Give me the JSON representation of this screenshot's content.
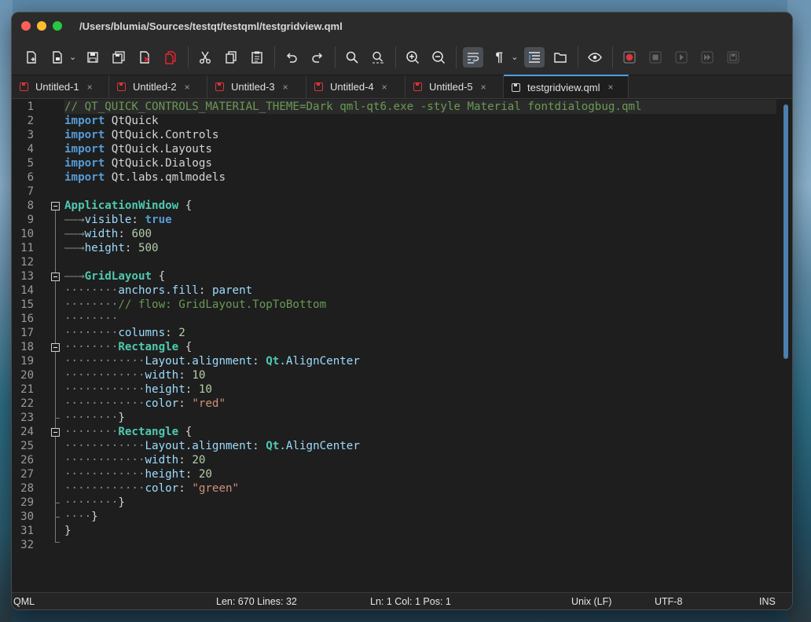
{
  "window": {
    "title": "/Users/blumia/Sources/testqt/testqml/testgridview.qml"
  },
  "toolbar": {
    "buttons": [
      {
        "icon": "new-document-icon"
      },
      {
        "icon": "open-file-icon"
      },
      {
        "icon": "save-icon"
      },
      {
        "icon": "save-all-icon"
      },
      {
        "icon": "close-file-icon"
      },
      {
        "icon": "close-all-icon"
      },
      {
        "icon": "cut-icon"
      },
      {
        "icon": "copy-icon"
      },
      {
        "icon": "paste-icon"
      },
      {
        "icon": "undo-icon"
      },
      {
        "icon": "redo-icon"
      },
      {
        "icon": "find-icon"
      },
      {
        "icon": "find-replace-icon"
      },
      {
        "icon": "zoom-in-icon"
      },
      {
        "icon": "zoom-out-icon"
      },
      {
        "icon": "word-wrap-icon"
      },
      {
        "icon": "show-whitespace-icon"
      },
      {
        "icon": "indent-guide-icon"
      },
      {
        "icon": "folder-icon"
      },
      {
        "icon": "preview-eye-icon"
      },
      {
        "icon": "record-macro-icon"
      },
      {
        "icon": "stop-macro-icon"
      },
      {
        "icon": "play-macro-icon"
      },
      {
        "icon": "run-macro-multiple-icon"
      },
      {
        "icon": "save-macro-icon"
      }
    ]
  },
  "tabs": [
    {
      "label": "Untitled-1",
      "close": "×",
      "active": false
    },
    {
      "label": "Untitled-2",
      "close": "×",
      "active": false
    },
    {
      "label": "Untitled-3",
      "close": "×",
      "active": false
    },
    {
      "label": "Untitled-4",
      "close": "×",
      "active": false
    },
    {
      "label": "Untitled-5",
      "close": "×",
      "active": false
    },
    {
      "label": "testgridview.qml",
      "close": "×",
      "active": true
    }
  ],
  "editor": {
    "line_numbers": [
      "1",
      "2",
      "3",
      "4",
      "5",
      "6",
      "7",
      "8",
      "9",
      "10",
      "11",
      "12",
      "13",
      "14",
      "15",
      "16",
      "17",
      "18",
      "19",
      "20",
      "21",
      "22",
      "23",
      "24",
      "25",
      "26",
      "27",
      "28",
      "29",
      "30",
      "31",
      "32"
    ],
    "lines": [
      [
        {
          "cls": "c",
          "text": "// QT_QUICK_CONTROLS_MATERIAL_THEME=Dark qml-qt6.exe -style Material fontdialogbug.qml"
        }
      ],
      [
        {
          "cls": "k",
          "text": "import"
        },
        {
          "cls": "",
          "text": " QtQuick"
        }
      ],
      [
        {
          "cls": "k",
          "text": "import"
        },
        {
          "cls": "",
          "text": " QtQuick.Controls"
        }
      ],
      [
        {
          "cls": "k",
          "text": "import"
        },
        {
          "cls": "",
          "text": " QtQuick.Layouts"
        }
      ],
      [
        {
          "cls": "k",
          "text": "import"
        },
        {
          "cls": "",
          "text": " QtQuick.Dialogs"
        }
      ],
      [
        {
          "cls": "k",
          "text": "import"
        },
        {
          "cls": "",
          "text": " Qt.labs.qmlmodels"
        }
      ],
      [
        {
          "cls": "",
          "text": ""
        }
      ],
      [
        {
          "cls": "t",
          "text": "ApplicationWindow"
        },
        {
          "cls": "",
          "text": " {"
        }
      ],
      [
        {
          "cls": "a",
          "text": "——→"
        },
        {
          "cls": "p",
          "text": "visible"
        },
        {
          "cls": "",
          "text": ": "
        },
        {
          "cls": "k",
          "text": "true"
        }
      ],
      [
        {
          "cls": "a",
          "text": "——→"
        },
        {
          "cls": "p",
          "text": "width"
        },
        {
          "cls": "",
          "text": ": "
        },
        {
          "cls": "n",
          "text": "600"
        }
      ],
      [
        {
          "cls": "a",
          "text": "——→"
        },
        {
          "cls": "p",
          "text": "height"
        },
        {
          "cls": "",
          "text": ": "
        },
        {
          "cls": "n",
          "text": "500"
        }
      ],
      [
        {
          "cls": "",
          "text": ""
        }
      ],
      [
        {
          "cls": "a",
          "text": "——→"
        },
        {
          "cls": "t",
          "text": "GridLayout"
        },
        {
          "cls": "",
          "text": " {"
        }
      ],
      [
        {
          "cls": "a",
          "text": "········"
        },
        {
          "cls": "p",
          "text": "anchors.fill"
        },
        {
          "cls": "",
          "text": ": "
        },
        {
          "cls": "p",
          "text": "parent"
        }
      ],
      [
        {
          "cls": "a",
          "text": "········"
        },
        {
          "cls": "c",
          "text": "// flow: GridLayout.TopToBottom"
        }
      ],
      [
        {
          "cls": "a",
          "text": "········"
        }
      ],
      [
        {
          "cls": "a",
          "text": "········"
        },
        {
          "cls": "p",
          "text": "columns"
        },
        {
          "cls": "",
          "text": ": "
        },
        {
          "cls": "n",
          "text": "2"
        }
      ],
      [
        {
          "cls": "a",
          "text": "········"
        },
        {
          "cls": "t",
          "text": "Rectangle"
        },
        {
          "cls": "",
          "text": " {"
        }
      ],
      [
        {
          "cls": "a",
          "text": "············"
        },
        {
          "cls": "p",
          "text": "Layout.alignment"
        },
        {
          "cls": "",
          "text": ": "
        },
        {
          "cls": "t",
          "text": "Qt"
        },
        {
          "cls": "p",
          "text": ".AlignCenter"
        }
      ],
      [
        {
          "cls": "a",
          "text": "············"
        },
        {
          "cls": "p",
          "text": "width"
        },
        {
          "cls": "",
          "text": ": "
        },
        {
          "cls": "n",
          "text": "10"
        }
      ],
      [
        {
          "cls": "a",
          "text": "············"
        },
        {
          "cls": "p",
          "text": "height"
        },
        {
          "cls": "",
          "text": ": "
        },
        {
          "cls": "n",
          "text": "10"
        }
      ],
      [
        {
          "cls": "a",
          "text": "············"
        },
        {
          "cls": "p",
          "text": "color"
        },
        {
          "cls": "",
          "text": ": "
        },
        {
          "cls": "s",
          "text": "\"red\""
        }
      ],
      [
        {
          "cls": "a",
          "text": "········"
        },
        {
          "cls": "",
          "text": "}"
        }
      ],
      [
        {
          "cls": "a",
          "text": "········"
        },
        {
          "cls": "t",
          "text": "Rectangle"
        },
        {
          "cls": "",
          "text": " {"
        }
      ],
      [
        {
          "cls": "a",
          "text": "············"
        },
        {
          "cls": "p",
          "text": "Layout.alignment"
        },
        {
          "cls": "",
          "text": ": "
        },
        {
          "cls": "t",
          "text": "Qt"
        },
        {
          "cls": "p",
          "text": ".AlignCenter"
        }
      ],
      [
        {
          "cls": "a",
          "text": "············"
        },
        {
          "cls": "p",
          "text": "width"
        },
        {
          "cls": "",
          "text": ": "
        },
        {
          "cls": "n",
          "text": "20"
        }
      ],
      [
        {
          "cls": "a",
          "text": "············"
        },
        {
          "cls": "p",
          "text": "height"
        },
        {
          "cls": "",
          "text": ": "
        },
        {
          "cls": "n",
          "text": "20"
        }
      ],
      [
        {
          "cls": "a",
          "text": "············"
        },
        {
          "cls": "p",
          "text": "color"
        },
        {
          "cls": "",
          "text": ": "
        },
        {
          "cls": "s",
          "text": "\"green\""
        }
      ],
      [
        {
          "cls": "a",
          "text": "········"
        },
        {
          "cls": "",
          "text": "}"
        }
      ],
      [
        {
          "cls": "a",
          "text": "····"
        },
        {
          "cls": "",
          "text": "}"
        }
      ],
      [
        {
          "cls": "",
          "text": "}"
        }
      ],
      [
        {
          "cls": "",
          "text": ""
        }
      ]
    ]
  },
  "statusbar": {
    "language": "QML",
    "length": "Len: 670  Lines: 32",
    "position": "Ln: 1  Col: 1  Pos: 1",
    "eol": "Unix (LF)",
    "encoding": "UTF-8",
    "mode": "INS"
  },
  "colors": {
    "accent": "#4aa0e6",
    "keyword": "#569cd6",
    "type": "#4ec9b0",
    "property": "#9cdcfe",
    "number": "#b5cea8",
    "string": "#ce9178",
    "comment": "#6a9955"
  }
}
